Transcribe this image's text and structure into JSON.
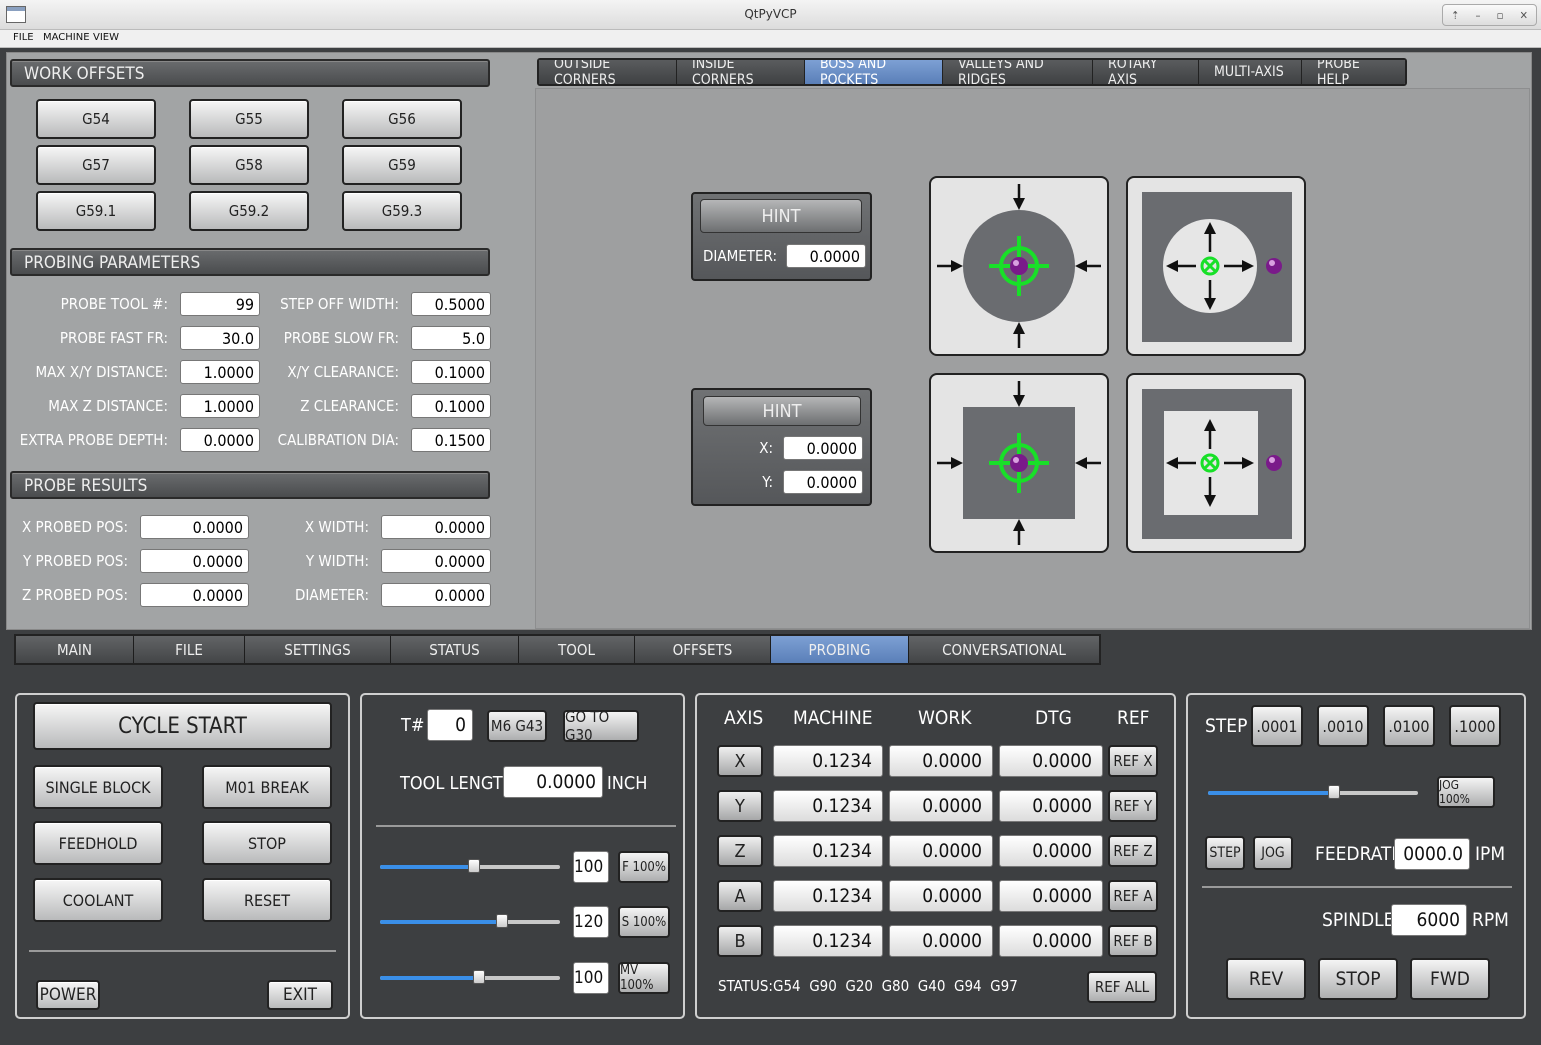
{
  "window": {
    "title": "QtPyVCP"
  },
  "menu": [
    "FILE",
    "MACHINE",
    "VIEW"
  ],
  "work_offsets": {
    "header": "WORK OFFSETS",
    "buttons": [
      "G54",
      "G55",
      "G56",
      "G57",
      "G58",
      "G59",
      "G59.1",
      "G59.2",
      "G59.3"
    ]
  },
  "probing_params": {
    "header": "PROBING PARAMETERS",
    "left": [
      {
        "label": "PROBE TOOL #:",
        "value": "99"
      },
      {
        "label": "PROBE FAST FR:",
        "value": "30.0"
      },
      {
        "label": "MAX X/Y DISTANCE:",
        "value": "1.0000"
      },
      {
        "label": "MAX Z DISTANCE:",
        "value": "1.0000"
      },
      {
        "label": "EXTRA PROBE DEPTH:",
        "value": "0.0000"
      }
    ],
    "right": [
      {
        "label": "STEP OFF WIDTH:",
        "value": "0.5000"
      },
      {
        "label": "PROBE SLOW FR:",
        "value": "5.0"
      },
      {
        "label": "X/Y CLEARANCE:",
        "value": "0.1000"
      },
      {
        "label": "Z CLEARANCE:",
        "value": "0.1000"
      },
      {
        "label": "CALIBRATION DIA:",
        "value": "0.1500"
      }
    ]
  },
  "probe_results": {
    "header": "PROBE RESULTS",
    "left": [
      {
        "label": "X PROBED POS:",
        "value": "0.0000"
      },
      {
        "label": "Y PROBED POS:",
        "value": "0.0000"
      },
      {
        "label": "Z PROBED POS:",
        "value": "0.0000"
      }
    ],
    "right": [
      {
        "label": "X WIDTH:",
        "value": "0.0000"
      },
      {
        "label": "Y WIDTH:",
        "value": "0.0000"
      },
      {
        "label": "DIAMETER:",
        "value": "0.0000"
      }
    ]
  },
  "probe_tabs": [
    "OUTSIDE CORNERS",
    "INSIDE CORNERS",
    "BOSS AND POCKETS",
    "VALLEYS AND RIDGES",
    "ROTARY AXIS",
    "MULTI-AXIS",
    "PROBE HELP"
  ],
  "hint1": {
    "button": "HINT",
    "label": "DIAMETER:",
    "value": "0.0000"
  },
  "hint2": {
    "button": "HINT",
    "x_label": "X:",
    "x_value": "0.0000",
    "y_label": "Y:",
    "y_value": "0.0000"
  },
  "main_tabs": [
    "MAIN",
    "FILE",
    "SETTINGS",
    "STATUS",
    "TOOL",
    "OFFSETS",
    "PROBING",
    "CONVERSATIONAL"
  ],
  "controls": {
    "cycle_start": "CYCLE START",
    "single_block": "SINGLE BLOCK",
    "m01_break": "M01 BREAK",
    "feedhold": "FEEDHOLD",
    "stop": "STOP",
    "coolant": "COOLANT",
    "reset": "RESET",
    "power": "POWER",
    "exit": "EXIT"
  },
  "tool": {
    "t_label": "T#",
    "t_value": "0",
    "m6": "M6 G43",
    "g30": "GO TO G30",
    "len_label": "TOOL LENGTH",
    "len_value": "0.0000",
    "len_unit": "INCH",
    "overrides": [
      {
        "value": "100",
        "button": "F 100%",
        "level": 0.52
      },
      {
        "value": "120",
        "button": "S 100%",
        "level": 0.68
      },
      {
        "value": "100",
        "button": "MV 100%",
        "level": 0.55
      }
    ]
  },
  "dro": {
    "headers": [
      "AXIS",
      "MACHINE",
      "WORK",
      "DTG",
      "REF"
    ],
    "rows": [
      {
        "axis": "X",
        "machine": "0.1234",
        "work": "0.0000",
        "dtg": "0.0000",
        "ref": "REF X"
      },
      {
        "axis": "Y",
        "machine": "0.1234",
        "work": "0.0000",
        "dtg": "0.0000",
        "ref": "REF Y"
      },
      {
        "axis": "Z",
        "machine": "0.1234",
        "work": "0.0000",
        "dtg": "0.0000",
        "ref": "REF Z"
      },
      {
        "axis": "A",
        "machine": "0.1234",
        "work": "0.0000",
        "dtg": "0.0000",
        "ref": "REF A"
      },
      {
        "axis": "B",
        "machine": "0.1234",
        "work": "0.0000",
        "dtg": "0.0000",
        "ref": "REF B"
      }
    ],
    "status_label": "STATUS:",
    "status_codes": "G54  G90  G20  G80  G40  G94  G97",
    "ref_all": "REF ALL"
  },
  "jog": {
    "step_label": "STEP",
    "steps": [
      ".0001",
      ".0010",
      ".0100",
      ".1000"
    ],
    "jog_pct": "JOG 100%",
    "jog_level": 0.6,
    "step_btn": "STEP",
    "jog_btn": "JOG",
    "feed_label": "FEEDRATE",
    "feed_value": "0000.0",
    "feed_unit": "IPM",
    "spindle_label": "SPINDLE",
    "spindle_value": "6000",
    "spindle_unit": "RPM",
    "rev": "REV",
    "stop": "STOP",
    "fwd": "FWD"
  },
  "colors": {
    "accent": "#6a8fcb",
    "probe_green": "#18e028",
    "probe_ball": "#7a1a8a",
    "slider": "#3a8fe8"
  }
}
